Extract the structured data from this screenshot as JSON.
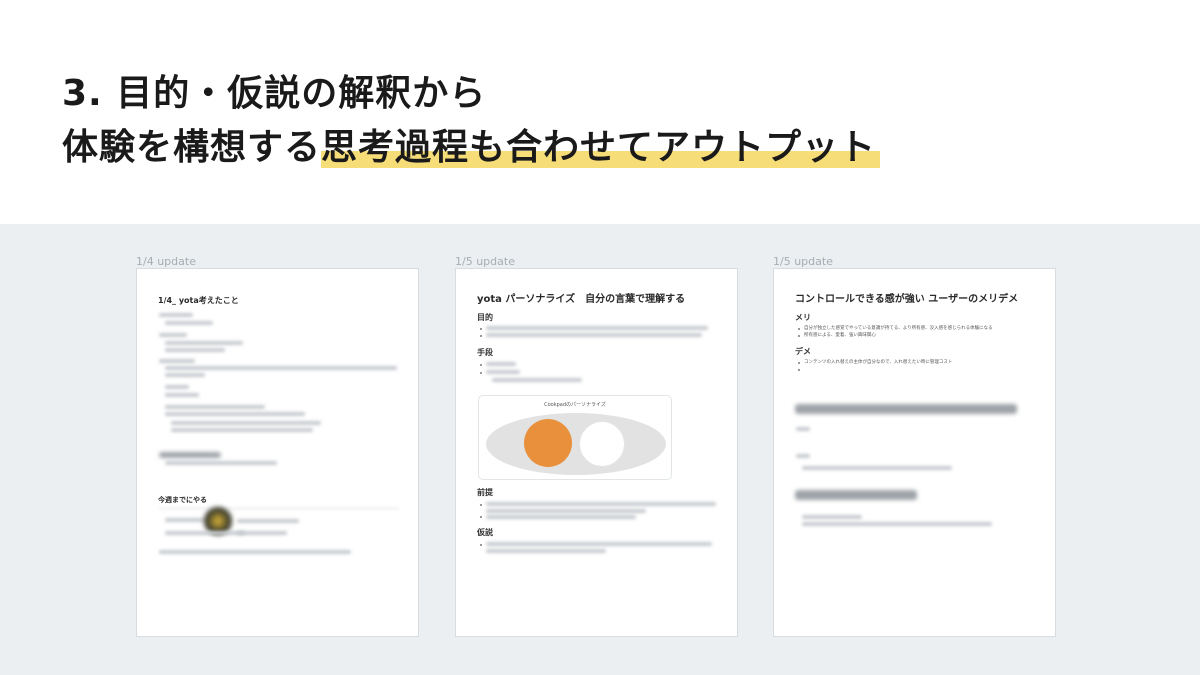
{
  "header": {
    "line1": "3. 目的・仮説の解釈から",
    "line2_plain": "体験を構想する",
    "line2_highlight": "思考過程も合わせてアウトプット",
    "highlight_color": "#f7dd78"
  },
  "docs": [
    {
      "label": "1/4 update",
      "title": "1/4_ yota考えたこと",
      "section": "今週までにやる"
    },
    {
      "label": "1/5 update",
      "title": "yota パーソナライズ　自分の言葉で理解する",
      "sections": [
        "目的",
        "手段",
        "前提",
        "仮説"
      ],
      "diagram_label": "Cookpadのパーソナライズ",
      "accent": "#e8903b"
    },
    {
      "label": "1/5 update",
      "title": "コントロールできる感が強い ユーザーのメリデメ",
      "merit_heading": "メリ",
      "merit_items": [
        "自分が独立した感覚でやっている意識が持てる、より所有感、没入感を感じられる体験になる",
        "所有感による、愛着、強い興味関心"
      ],
      "demerit_heading": "デメ",
      "demerit_items": [
        "コンテンツの入れ替えの主体が自分なので、入れ替えたい時に管理コスト"
      ]
    }
  ]
}
